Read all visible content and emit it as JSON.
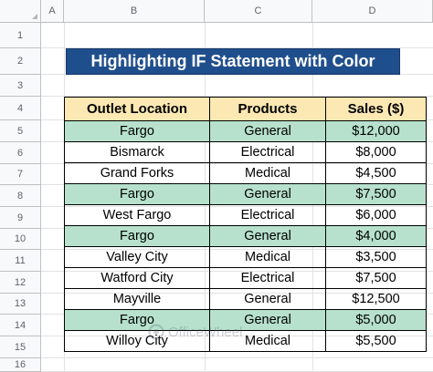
{
  "sheet": {
    "columns": [
      "A",
      "B",
      "C",
      "D"
    ],
    "rows": [
      "1",
      "2",
      "3",
      "4",
      "5",
      "6",
      "7",
      "8",
      "9",
      "10",
      "11",
      "12",
      "13",
      "14",
      "15",
      "16"
    ]
  },
  "title": "Highlighting IF Statement with Color",
  "table": {
    "headers": [
      "Outlet Location",
      "Products",
      "Sales ($)"
    ],
    "rows": [
      {
        "location": "Fargo",
        "product": "General",
        "sales": "$12,000",
        "highlight": true
      },
      {
        "location": "Bismarck",
        "product": "Electrical",
        "sales": "$8,000",
        "highlight": false
      },
      {
        "location": "Grand Forks",
        "product": "Medical",
        "sales": "$4,500",
        "highlight": false
      },
      {
        "location": "Fargo",
        "product": "General",
        "sales": "$7,500",
        "highlight": true
      },
      {
        "location": "West Fargo",
        "product": "Electrical",
        "sales": "$6,000",
        "highlight": false
      },
      {
        "location": "Fargo",
        "product": "General",
        "sales": "$4,000",
        "highlight": true
      },
      {
        "location": "Valley City",
        "product": "Medical",
        "sales": "$3,500",
        "highlight": false
      },
      {
        "location": "Watford City",
        "product": "Electrical",
        "sales": "$7,500",
        "highlight": false
      },
      {
        "location": "Mayville",
        "product": "General",
        "sales": "$12,500",
        "highlight": false
      },
      {
        "location": "Fargo",
        "product": "General",
        "sales": "$5,000",
        "highlight": true
      },
      {
        "location": "Willoy City",
        "product": "Medical",
        "sales": "$5,500",
        "highlight": false
      }
    ]
  },
  "watermark": "OfficeWheel",
  "colors": {
    "title_bg": "#1f4e8c",
    "header_bg": "#fce8b2",
    "highlight_bg": "#b7e1cd",
    "header_chrome": "#f8f9fa"
  }
}
